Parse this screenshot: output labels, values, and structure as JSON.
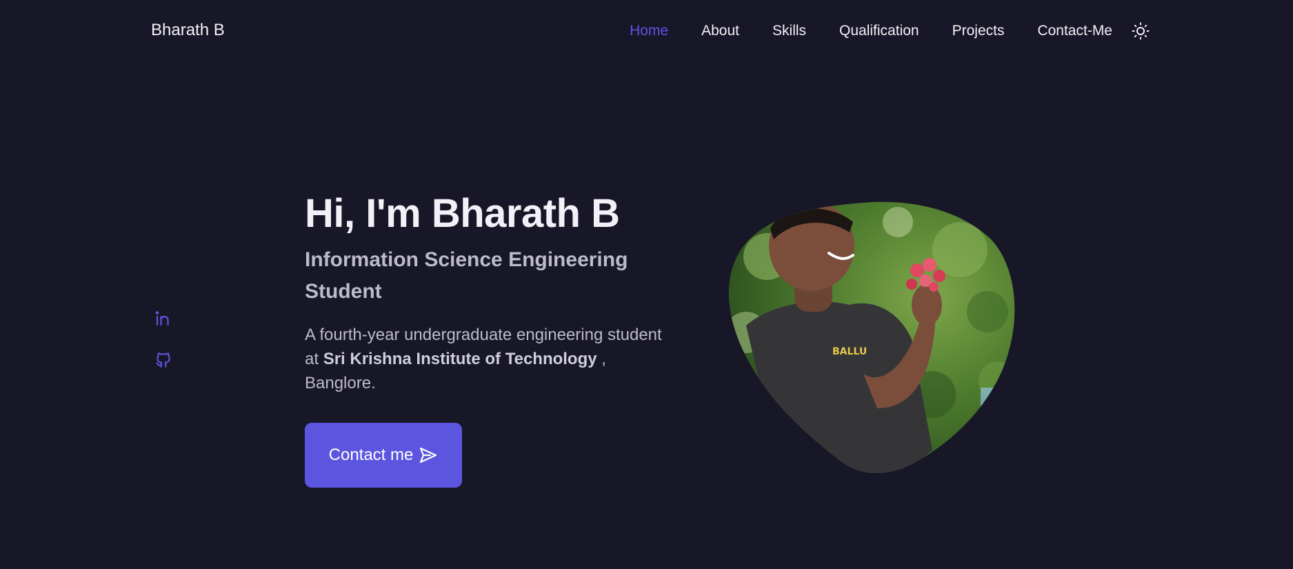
{
  "header": {
    "logo": "Bharath B",
    "nav": [
      {
        "label": "Home",
        "active": true
      },
      {
        "label": "About",
        "active": false
      },
      {
        "label": "Skills",
        "active": false
      },
      {
        "label": "Qualification",
        "active": false
      },
      {
        "label": "Projects",
        "active": false
      },
      {
        "label": "Contact-Me",
        "active": false
      }
    ],
    "theme_icon": "sun-icon"
  },
  "socials": [
    {
      "icon": "linkedin-icon"
    },
    {
      "icon": "github-icon"
    }
  ],
  "hero": {
    "title": "Hi, I'm Bharath B",
    "subtitle": "Information Science Engineering Student",
    "desc_prefix": "A fourth-year undergraduate engineering student at ",
    "desc_bold": "Sri Krishna Institute of Technology",
    "desc_suffix": " , Banglore.",
    "button_label": "Contact me",
    "button_icon": "send-icon",
    "tshirt_text": "BALLU"
  },
  "colors": {
    "background": "#181727",
    "accent": "#5b55e0",
    "text": "#f2f1f7",
    "muted": "#bcbbc9"
  }
}
